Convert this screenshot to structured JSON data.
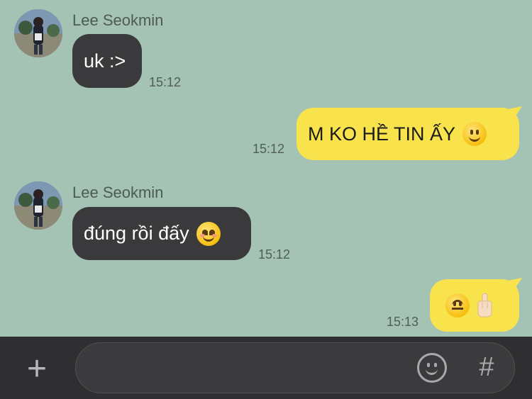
{
  "messages": [
    {
      "sender": "Lee Seokmin",
      "text": "uk :>",
      "time": "15:12"
    },
    {
      "text": "M KO HỀ TIN ẤY",
      "time": "15:12"
    },
    {
      "sender": "Lee Seokmin",
      "text": "đúng rồi đấy",
      "time": "15:12"
    },
    {
      "text": "",
      "time": "15:13"
    }
  ],
  "icons": {
    "emoji_1": "slightly-smiling-face",
    "emoji_2": "smiling-face-with-smiling-eyes",
    "emoji_3": "upside-down-face",
    "emoji_4": "middle-finger",
    "composer_left": "plus-icon",
    "composer_right_1": "emoji-icon",
    "composer_right_2": "hashtag-icon"
  },
  "composer": {
    "plus": "+",
    "hash": "#"
  },
  "colors": {
    "background": "#a4c3b4",
    "incoming_bubble": "#3a3a3c",
    "outgoing_bubble": "#f9e34c",
    "bottom_bar": "#2f2f31"
  }
}
